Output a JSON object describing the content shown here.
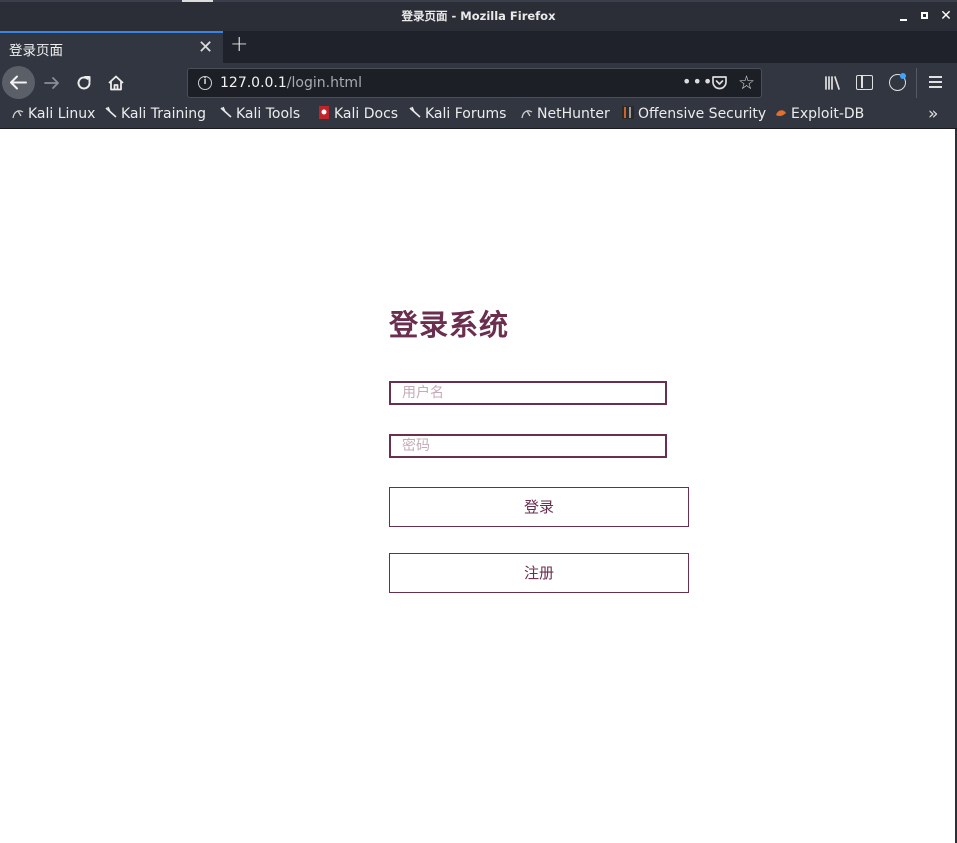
{
  "window": {
    "title": "登录页面 - Mozilla Firefox"
  },
  "tabs": [
    {
      "label": "登录页面"
    }
  ],
  "urlbar": {
    "host": "127.0.0.1",
    "path": "/login.html",
    "more": "•••"
  },
  "bookmarks": [
    {
      "label": "Kali Linux",
      "icon": "kali-dragon-icon"
    },
    {
      "label": "Kali Training",
      "icon": "kali-dragon-icon"
    },
    {
      "label": "Kali Tools",
      "icon": "kali-dragon-icon"
    },
    {
      "label": "Kali Docs",
      "icon": "kali-docs-icon"
    },
    {
      "label": "Kali Forums",
      "icon": "kali-dragon-icon"
    },
    {
      "label": "NetHunter",
      "icon": "kali-dragon-icon"
    },
    {
      "label": "Offensive Security",
      "icon": "offsec-icon"
    },
    {
      "label": "Exploit-DB",
      "icon": "exploitdb-icon"
    }
  ],
  "login": {
    "title": "登录系统",
    "username_placeholder": "用户名",
    "password_placeholder": "密码",
    "login_label": "登录",
    "register_label": "注册"
  },
  "colors": {
    "accent": "#6a2e4f",
    "chrome": "#323640",
    "tab_highlight": "#3a83e0"
  }
}
